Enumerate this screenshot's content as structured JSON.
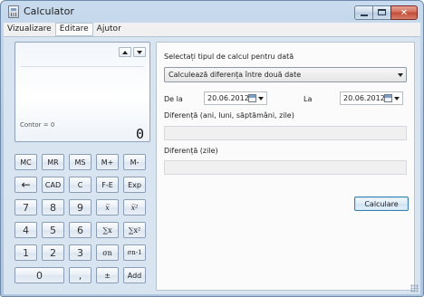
{
  "window": {
    "title": "Calculator"
  },
  "menu": [
    {
      "label": "Vizualizare"
    },
    {
      "label": "Editare"
    },
    {
      "label": "Ajutor"
    }
  ],
  "display": {
    "memory_text": "Contor = 0",
    "value": "0"
  },
  "keypad": {
    "row1": [
      "MC",
      "MR",
      "MS",
      "M+",
      "M-"
    ],
    "row2": [
      "←",
      "CAD",
      "C",
      "F-E",
      "Exp"
    ],
    "row3": [
      "7",
      "8",
      "9",
      "x̅",
      "x̅²"
    ],
    "row4": [
      "4",
      "5",
      "6",
      "∑x",
      "∑x²"
    ],
    "row5": [
      "1",
      "2",
      "3",
      "σn",
      "σn-1"
    ],
    "row6": [
      "0",
      ",",
      "±",
      "Add"
    ]
  },
  "date_panel": {
    "calc_type_label": "Selectați tipul de calcul pentru dată",
    "calc_type_value": "Calculează diferența între două date",
    "from_label": "De la",
    "from_date": "20.06.2012",
    "to_label": "La",
    "to_date": "20.06.2012",
    "diff_label": "Diferență (ani, luni, săptămâni, zile)",
    "diff_days_label": "Diferență (zile)",
    "calculate_button": "Calculare"
  }
}
